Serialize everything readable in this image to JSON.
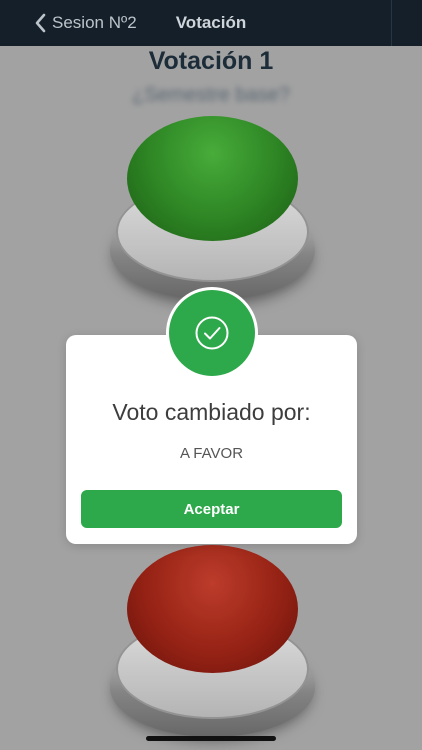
{
  "nav": {
    "back_label": "Sesion Nº2",
    "title": "Votación"
  },
  "screen": {
    "title": "Votación 1",
    "question": "¿Semestre base?"
  },
  "buttons": {
    "green_color": "#2f8a25",
    "red_color": "#9c2416"
  },
  "dialog": {
    "heading": "Voto cambiado por:",
    "value": "A FAVOR",
    "accept_label": "Aceptar",
    "accent": "#2da84a",
    "icon": "check-circle-icon"
  }
}
